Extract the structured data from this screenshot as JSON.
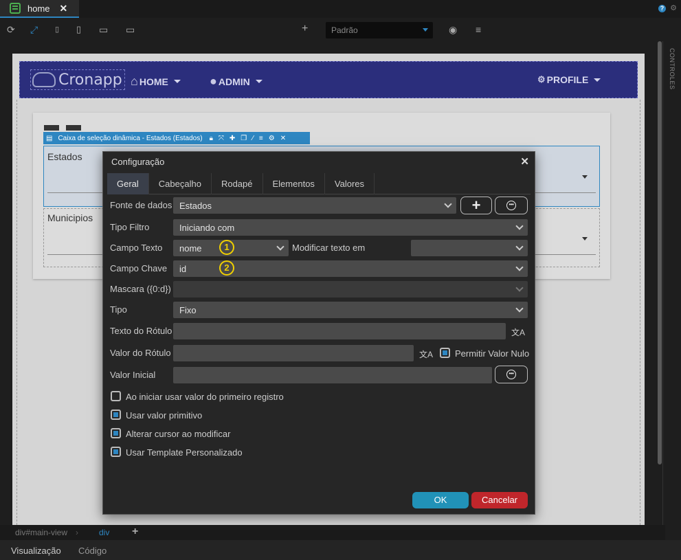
{
  "tabbar": {
    "tab_label": "home",
    "close": "✕",
    "help": "?"
  },
  "toolbar": {
    "device_select": "Padrão"
  },
  "right_panel": {
    "label": "CONTROLES"
  },
  "app": {
    "logo_text": "Cronapp",
    "nav": {
      "home": "HOME",
      "admin": "ADMIN",
      "profile": "PROFILE"
    }
  },
  "component_toolbar": {
    "title": "Caixa de seleção dinâmica - Estados (Estados)"
  },
  "form": {
    "estados_label": "Estados",
    "municipios_label": "Municipios"
  },
  "dialog": {
    "title": "Configuração",
    "tabs": [
      "Geral",
      "Cabeçalho",
      "Rodapé",
      "Elementos",
      "Valores"
    ],
    "fields": {
      "fonte_dados": {
        "label": "Fonte de dados",
        "value": "Estados"
      },
      "tipo_filtro": {
        "label": "Tipo Filtro",
        "value": "Iniciando com"
      },
      "campo_texto": {
        "label": "Campo Texto",
        "value": "nome"
      },
      "modificar_texto": {
        "label": "Modificar texto em",
        "value": ""
      },
      "campo_chave": {
        "label": "Campo Chave",
        "value": "id"
      },
      "mascara": {
        "label": "Mascara ({0:d})",
        "value": ""
      },
      "tipo": {
        "label": "Tipo",
        "value": "Fixo"
      },
      "texto_rotulo": {
        "label": "Texto do Rótulo",
        "value": ""
      },
      "valor_rotulo": {
        "label": "Valor do Rótulo",
        "value": ""
      },
      "permitir_nulo": {
        "label": "Permitir Valor Nulo",
        "checked": true
      },
      "valor_inicial": {
        "label": "Valor Inicial",
        "value": ""
      }
    },
    "badges": {
      "one": "1",
      "two": "2"
    },
    "checkboxes": [
      {
        "label": "Ao iniciar usar valor do primeiro registro",
        "checked": false
      },
      {
        "label": "Usar valor primitivo",
        "checked": true
      },
      {
        "label": "Alterar cursor ao modificar",
        "checked": true
      },
      {
        "label": "Usar Template Personalizado",
        "checked": true
      }
    ],
    "ok_label": "OK",
    "cancel_label": "Cancelar"
  },
  "breadcrumb": {
    "item1": "div#main-view",
    "item2": "div"
  },
  "bottom_tabs": {
    "visualizacao": "Visualização",
    "codigo": "Código"
  },
  "colors": {
    "accent": "#2e86c1",
    "navbar": "#2b2e7c",
    "ok": "#2192b8",
    "cancel": "#c0262b",
    "badge": "#f0d000"
  }
}
